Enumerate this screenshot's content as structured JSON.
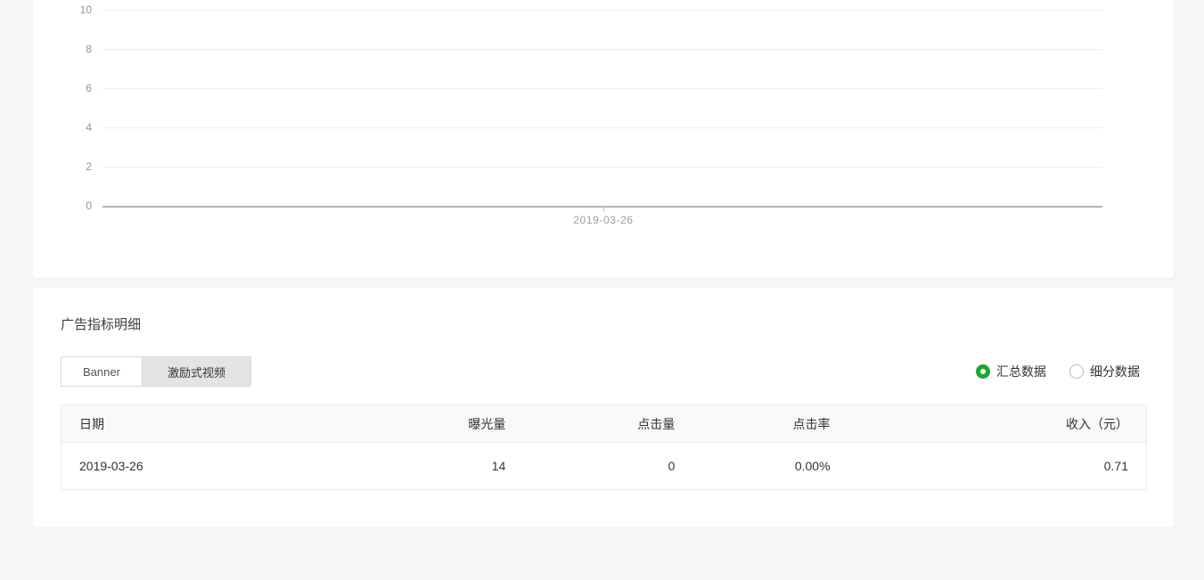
{
  "page": {
    "background": "#f5f6f8"
  },
  "chart_data": {
    "type": "line",
    "title": "",
    "xlabel": "",
    "ylabel": "",
    "x": [
      "2019-03-26"
    ],
    "xticks": [
      "2019-03-26"
    ],
    "series": [],
    "yticks": [
      0,
      2,
      4,
      6,
      8,
      10
    ],
    "ylim": [
      0,
      10
    ],
    "grid": true,
    "legend_position": "none"
  },
  "detail_section": {
    "title": "广告指标明细",
    "tabs": [
      {
        "label": "Banner",
        "active": false
      },
      {
        "label": "激励式视频",
        "active": true
      }
    ],
    "radios": [
      {
        "label": "汇总数据",
        "selected": true
      },
      {
        "label": "细分数据",
        "selected": false
      }
    ],
    "radio_color": "#21a532",
    "table": {
      "columns": [
        "日期",
        "曝光量",
        "点击量",
        "点击率",
        "收入（元）"
      ],
      "rows": [
        [
          "2019-03-26",
          "14",
          "0",
          "0.00%",
          "0.71"
        ]
      ]
    }
  }
}
